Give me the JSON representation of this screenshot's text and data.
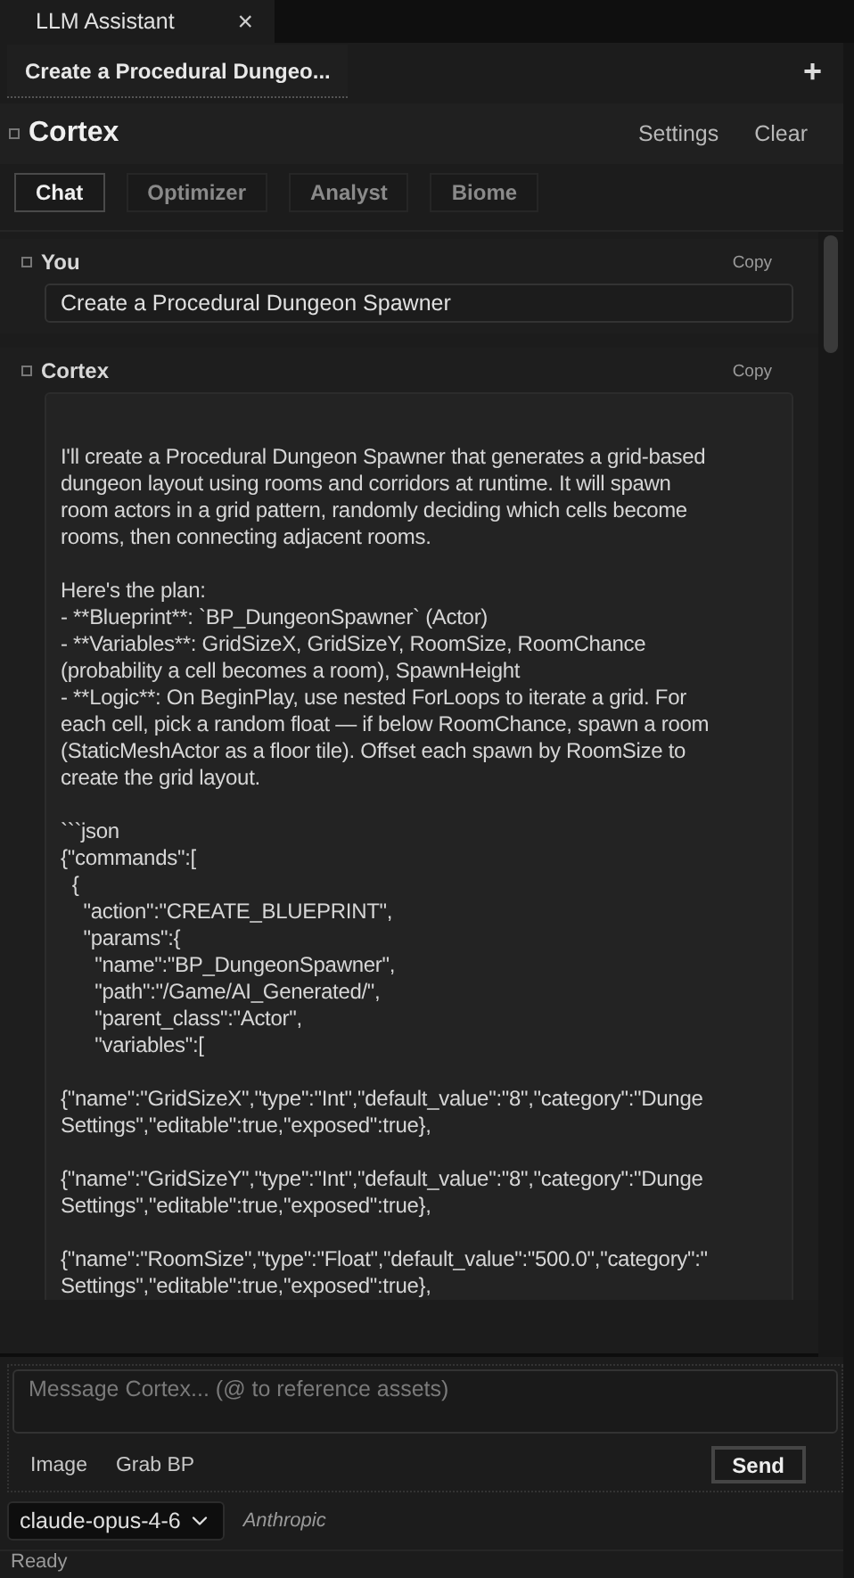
{
  "window_tab": {
    "title": "LLM Assistant",
    "close": "×"
  },
  "session_tabs": [
    {
      "label": "Create a Procedural Dungeo...",
      "selected": true
    }
  ],
  "new_session": "+",
  "header": {
    "title": "Cortex",
    "actions": [
      "Settings",
      "Clear"
    ]
  },
  "modes": [
    {
      "label": "Chat",
      "selected": true
    },
    {
      "label": "Optimizer",
      "selected": false
    },
    {
      "label": "Analyst",
      "selected": false
    },
    {
      "label": "Biome",
      "selected": false
    }
  ],
  "messages": [
    {
      "kind": "user",
      "author": "You",
      "copy": "Copy",
      "text": "Create a Procedural Dungeon Spawner"
    },
    {
      "kind": "assistant",
      "author": "Cortex",
      "copy": "Copy",
      "blocks": [
        [
          "I'll create a Procedural Dungeon Spawner that generates a grid-based",
          "dungeon layout using rooms and corridors at runtime. It will spawn",
          "room actors in a grid pattern, randomly deciding which cells become",
          "rooms, then connecting adjacent rooms."
        ],
        [
          "Here's the plan:",
          "- **Blueprint**: `BP_DungeonSpawner` (Actor)",
          "- **Variables**: GridSizeX, GridSizeY, RoomSize, RoomChance",
          "(probability a cell becomes a room), SpawnHeight",
          "- **Logic**: On BeginPlay, use nested ForLoops to iterate a grid. For",
          "each cell, pick a random float — if below RoomChance, spawn a room",
          "(StaticMeshActor as a floor tile). Offset each spawn by RoomSize to",
          "create the grid layout."
        ],
        [
          "```json",
          "{\"commands\":[",
          "  {",
          "    \"action\":\"CREATE_BLUEPRINT\",",
          "    \"params\":{",
          "      \"name\":\"BP_DungeonSpawner\",",
          "      \"path\":\"/Game/AI_Generated/\",",
          "      \"parent_class\":\"Actor\",",
          "      \"variables\":["
        ],
        [
          "{\"name\":\"GridSizeX\",\"type\":\"Int\",\"default_value\":\"8\",\"category\":\"Dunge",
          "Settings\",\"editable\":true,\"exposed\":true},"
        ],
        [
          "{\"name\":\"GridSizeY\",\"type\":\"Int\",\"default_value\":\"8\",\"category\":\"Dunge",
          "Settings\",\"editable\":true,\"exposed\":true},"
        ],
        [
          "{\"name\":\"RoomSize\",\"type\":\"Float\",\"default_value\":\"500.0\",\"category\":\"",
          "Settings\",\"editable\":true,\"exposed\":true},"
        ]
      ]
    }
  ],
  "composer": {
    "placeholder": "Message Cortex... (@ to reference assets)",
    "tools": [
      "Image",
      "Grab BP"
    ],
    "send": "Send"
  },
  "model": {
    "value": "claude-opus-4-6",
    "provider": "Anthropic"
  },
  "status_bar": "Ready"
}
